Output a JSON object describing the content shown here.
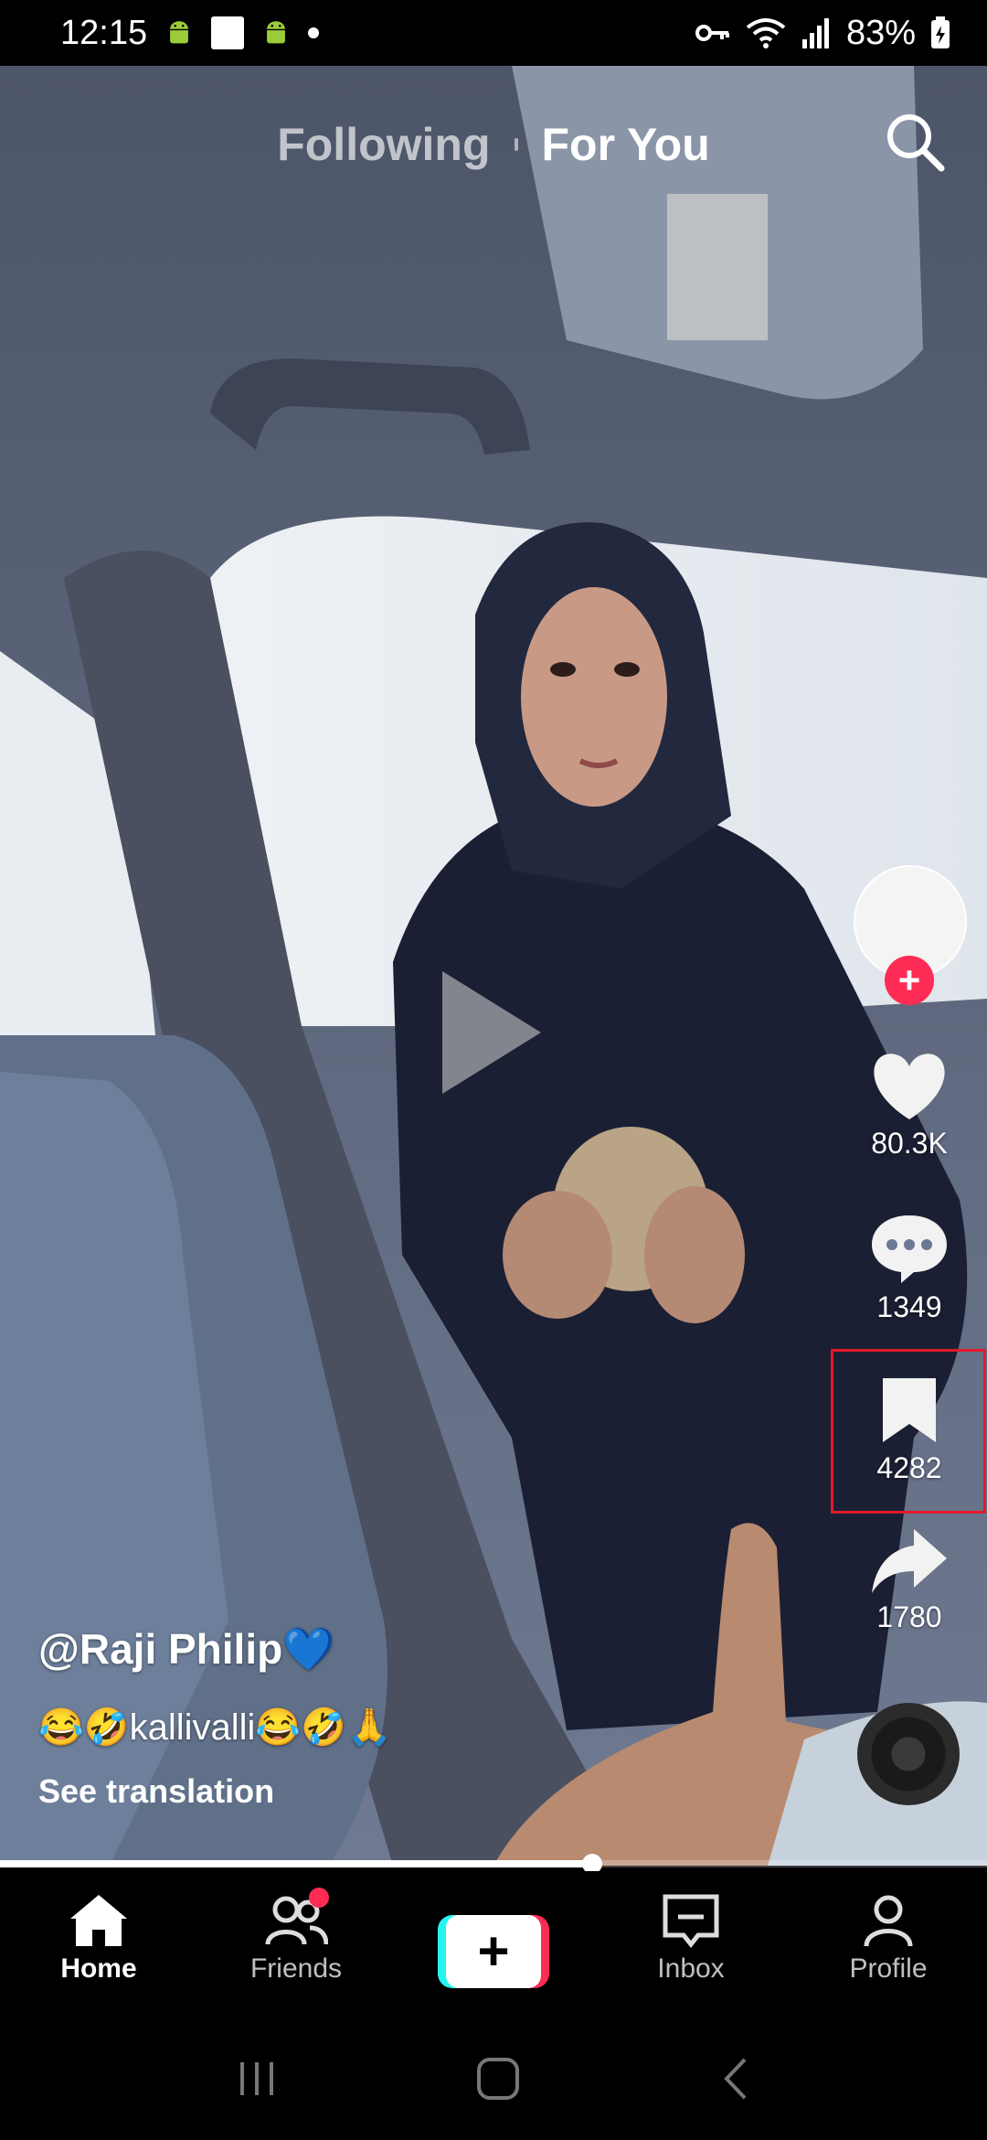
{
  "status_bar": {
    "time": "12:15",
    "battery": "83%"
  },
  "top_tabs": {
    "following": "Following",
    "for_you": "For You"
  },
  "actions": {
    "likes": "80.3K",
    "comments": "1349",
    "saves": "4282",
    "shares": "1780",
    "follow_symbol": "+"
  },
  "caption": {
    "username": "@Raji Philip💙",
    "description": "😂🤣kallivalli😂🤣🙏",
    "see_translation": "See translation"
  },
  "playback": {
    "progress": 0.6
  },
  "bottom_nav": {
    "home": "Home",
    "friends": "Friends",
    "create_symbol": "+",
    "inbox": "Inbox",
    "profile": "Profile"
  },
  "colors": {
    "accent_red": "#fe2c55",
    "accent_cyan": "#25f4ee",
    "highlight_box": "#e3192a"
  },
  "icons": [
    "android-icon",
    "search-icon",
    "play-icon",
    "heart-icon",
    "comment-icon",
    "bookmark-icon",
    "share-icon",
    "music-disc-icon",
    "home-icon",
    "friends-icon",
    "inbox-icon",
    "profile-icon",
    "key-icon",
    "wifi-icon",
    "signal-icon",
    "battery-icon"
  ]
}
